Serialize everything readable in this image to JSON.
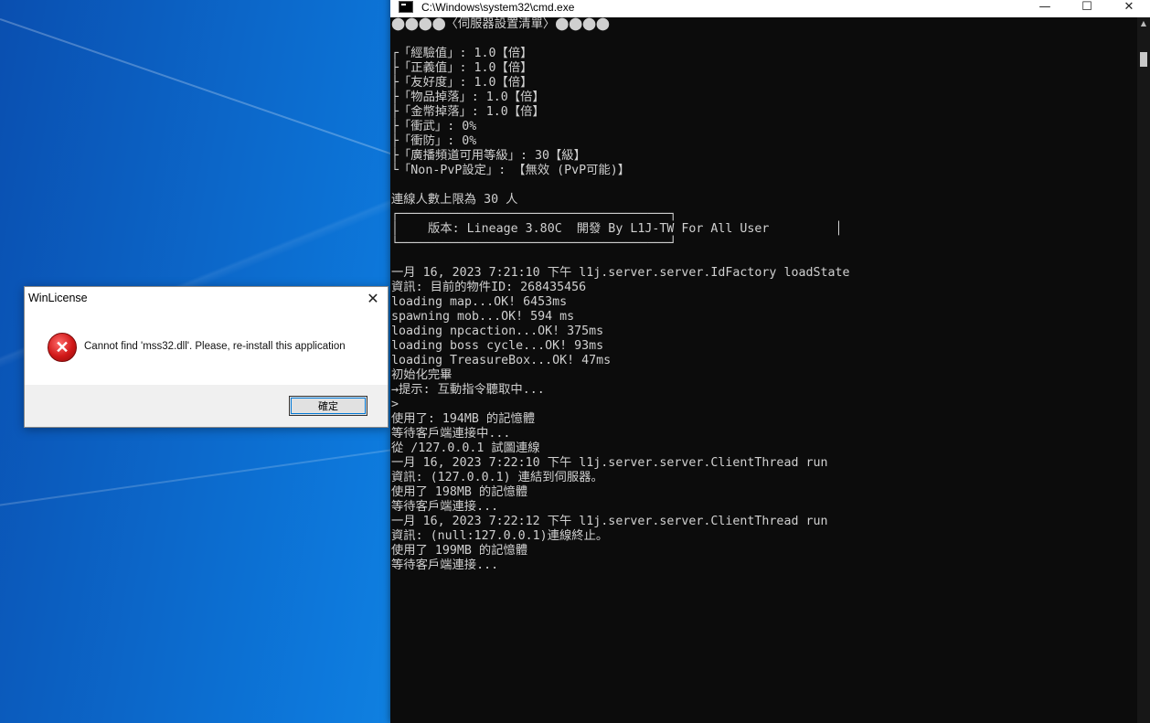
{
  "desktop": {},
  "console": {
    "title": "C:\\Windows\\system32\\cmd.exe",
    "controls": {
      "minimize": "—",
      "maximize": "☐",
      "close": "✕"
    },
    "lines": [
      "⬤⬤⬤⬤〈伺服器設置清單〉⬤⬤⬤⬤",
      "",
      "┌「經驗值」: 1.0【倍】",
      "├「正義值」: 1.0【倍】",
      "├「友好度」: 1.0【倍】",
      "├「物品掉落」: 1.0【倍】",
      "├「金幣掉落」: 1.0【倍】",
      "├「衝武」: 0%",
      "├「衝防」: 0%",
      "├「廣播頻道可用等級」: 30【級】",
      "└「Non-PvP設定」: 【無效 (PvP可能)】",
      "",
      "連線人數上限為 30 人",
      "┌─────────────────────────────────────┐",
      "│    版本: Lineage 3.80C  開發 By L1J-TW For All User         │",
      "└─────────────────────────────────────┘",
      "",
      "一月 16, 2023 7:21:10 下午 l1j.server.server.IdFactory loadState",
      "資訊: 目前的物件ID: 268435456",
      "loading map...OK! 6453ms",
      "spawning mob...OK! 594 ms",
      "loading npcaction...OK! 375ms",
      "loading boss cycle...OK! 93ms",
      "loading TreasureBox...OK! 47ms",
      "初始化完畢",
      "→提示: 互動指令聽取中...",
      ">",
      "使用了: 194MB 的記憶體",
      "等待客戶端連接中...",
      "從 /127.0.0.1 試圖連線",
      "一月 16, 2023 7:22:10 下午 l1j.server.server.ClientThread run",
      "資訊: (127.0.0.1) 連結到伺服器。",
      "使用了 198MB 的記憶體",
      "等待客戶端連接...",
      "一月 16, 2023 7:22:12 下午 l1j.server.server.ClientThread run",
      "資訊: (null:127.0.0.1)連線終止。",
      "使用了 199MB 的記憶體",
      "等待客戶端連接..."
    ]
  },
  "dialog": {
    "title": "WinLicense",
    "close": "✕",
    "icon": "error-icon",
    "icon_glyph": "✕",
    "message": "Cannot find 'mss32.dll'. Please, re-install this application",
    "ok_label": "確定",
    "colors": {
      "icon_red": "#d01818",
      "focus": "#0078d7"
    }
  }
}
